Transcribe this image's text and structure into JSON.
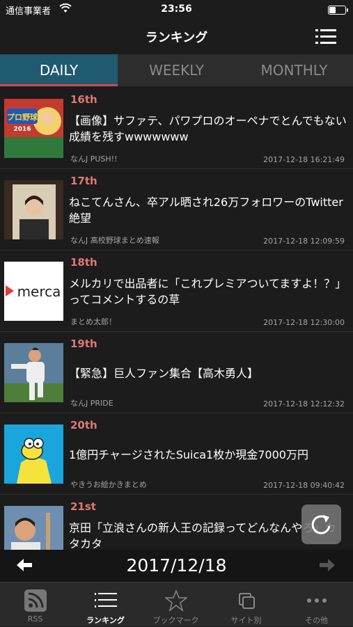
{
  "status_bar": {
    "carrier": "通信事業者",
    "time": "23:56",
    "battery_level": 0.45
  },
  "nav": {
    "title": "ランキング"
  },
  "tabs": [
    {
      "label": "DAILY",
      "active": true
    },
    {
      "label": "WEEKLY",
      "active": false
    },
    {
      "label": "MONTHLY",
      "active": false
    }
  ],
  "articles": [
    {
      "rank": "16th",
      "title": "【画像】サファテ、パワプロのオーペナでとんでもない成績を残すwwwwwww",
      "source": "なんJ PUSH!!",
      "datetime": "2017-12-18 16:21:49"
    },
    {
      "rank": "17th",
      "title": "ねこてんさん、卒アル晒され26万フォロワーのTwitter絶望",
      "source": "なんJ 高校野球まとめ速報",
      "datetime": "2017-12-18 12:09:59"
    },
    {
      "rank": "18th",
      "title": "メルカリで出品者に「これプレミアついてますよ！？」ってコメントするの草",
      "source": "まとめ太郎！",
      "datetime": "2017-12-18 12:30:00"
    },
    {
      "rank": "19th",
      "title": "【緊急】巨人ファン集合【高木勇人】",
      "source": "なんJ PRIDE",
      "datetime": "2017-12-18 12:12:32"
    },
    {
      "rank": "20th",
      "title": "1億円チャージされたSuica1枚か現金7000万円",
      "source": "やきうお絵かきまとめ",
      "datetime": "2017-12-18 09:40:42"
    },
    {
      "rank": "21st",
      "title": "京田「立浪さんの新人王の記録ってどんなんやろ」カタカタ",
      "source": "",
      "datetime": ""
    }
  ],
  "thumb_texts": {
    "pawapuro_logo": "プロ野球",
    "pawapuro_year": "2016",
    "mercari": "merca"
  },
  "date_nav": {
    "date": "2017/12/18"
  },
  "bottom_tabs": [
    {
      "label": "RSS",
      "icon": "rss-icon",
      "active": false
    },
    {
      "label": "ランキング",
      "icon": "ranking-list-icon",
      "active": true
    },
    {
      "label": "ブックマーク",
      "icon": "star-icon",
      "active": false
    },
    {
      "label": "サイト別",
      "icon": "sites-icon",
      "active": false
    },
    {
      "label": "その他",
      "icon": "more-icon",
      "active": false
    }
  ],
  "colors": {
    "accent_rank": "#e07777",
    "active_tab_bg": "#1f5a70",
    "active_tab_underline": "#d24a4a"
  }
}
